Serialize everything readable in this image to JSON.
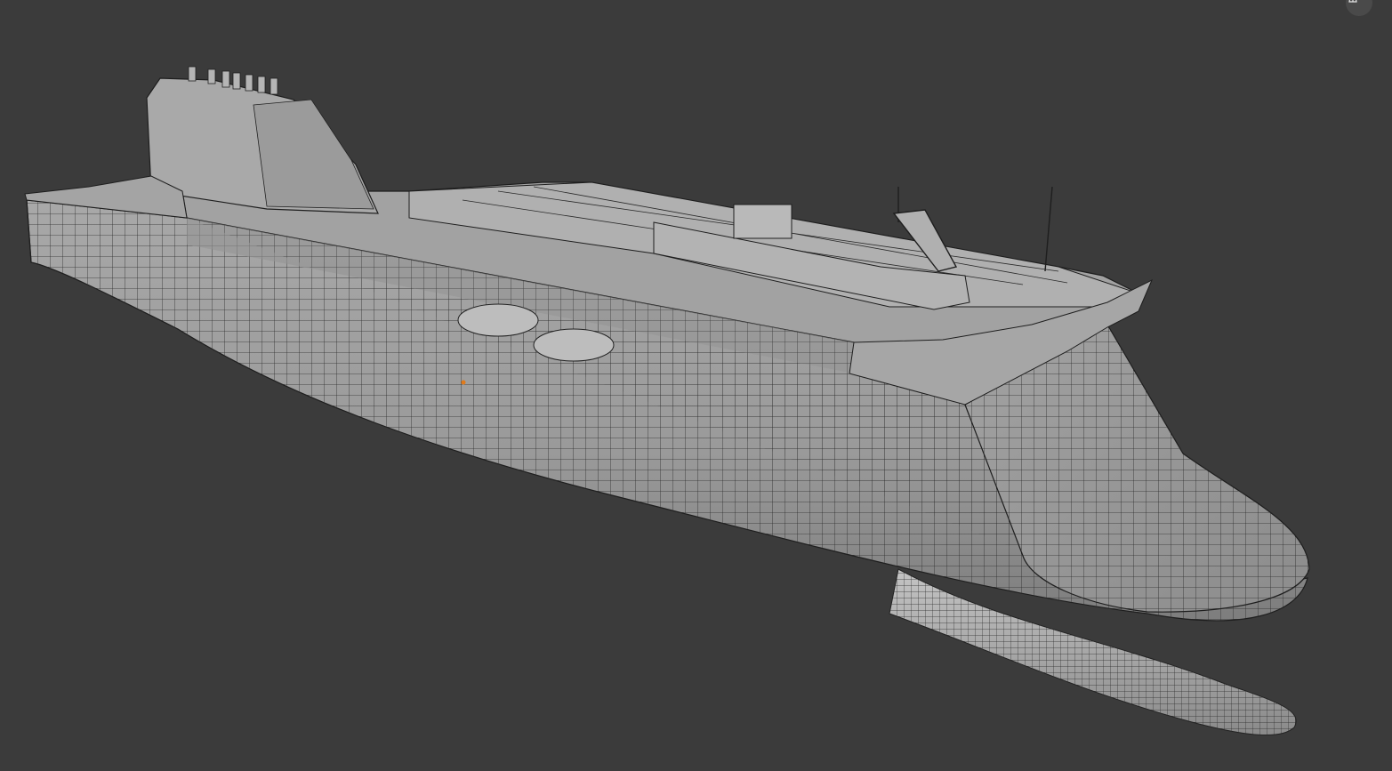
{
  "app": "3D viewport",
  "viewport": {
    "background": "#3b3b3b",
    "mesh_color": "#9a9a9a",
    "wire_color": "#2a2a2a",
    "origin_color": "#e07a1a"
  },
  "model": {
    "name": "",
    "type": "ship-hull-wireframe"
  },
  "overlay": {
    "gizmo_icon": "grid-perspective-icon"
  }
}
